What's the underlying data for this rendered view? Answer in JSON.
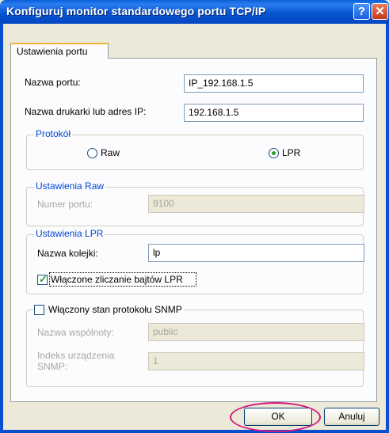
{
  "window": {
    "title": "Konfiguruj monitor standardowego portu TCP/IP",
    "help_glyph": "?",
    "close_glyph": "✕"
  },
  "tab": {
    "label": "Ustawienia portu"
  },
  "port_name": {
    "label": "Nazwa portu:",
    "value": "IP_192.168.1.5"
  },
  "printer_address": {
    "label": "Nazwa drukarki lub adres IP:",
    "value": "192.168.1.5"
  },
  "protocol": {
    "title": "Protokół",
    "raw_label": "Raw",
    "lpr_label": "LPR",
    "selected": "LPR"
  },
  "raw_settings": {
    "title": "Ustawienia Raw",
    "port_number_label": "Numer portu:",
    "port_number_value": "9100"
  },
  "lpr_settings": {
    "title": "Ustawienia LPR",
    "queue_label": "Nazwa kolejki:",
    "queue_value": "lp",
    "byte_counting_label": "Włączone zliczanie bajtów LPR",
    "byte_counting_checked": true
  },
  "snmp": {
    "title": "Włączony stan protokołu SNMP",
    "enabled": false,
    "community_label": "Nazwa wspólnoty:",
    "community_value": "public",
    "device_index_label": "Indeks urządzenia SNMP:",
    "device_index_value": "1"
  },
  "buttons": {
    "ok": "OK",
    "cancel": "Anuluj"
  },
  "colors": {
    "titlebar": "#0854d0",
    "group_label": "#0046d5",
    "highlight_ring": "#d4177f",
    "check_mark": "#21a121"
  }
}
